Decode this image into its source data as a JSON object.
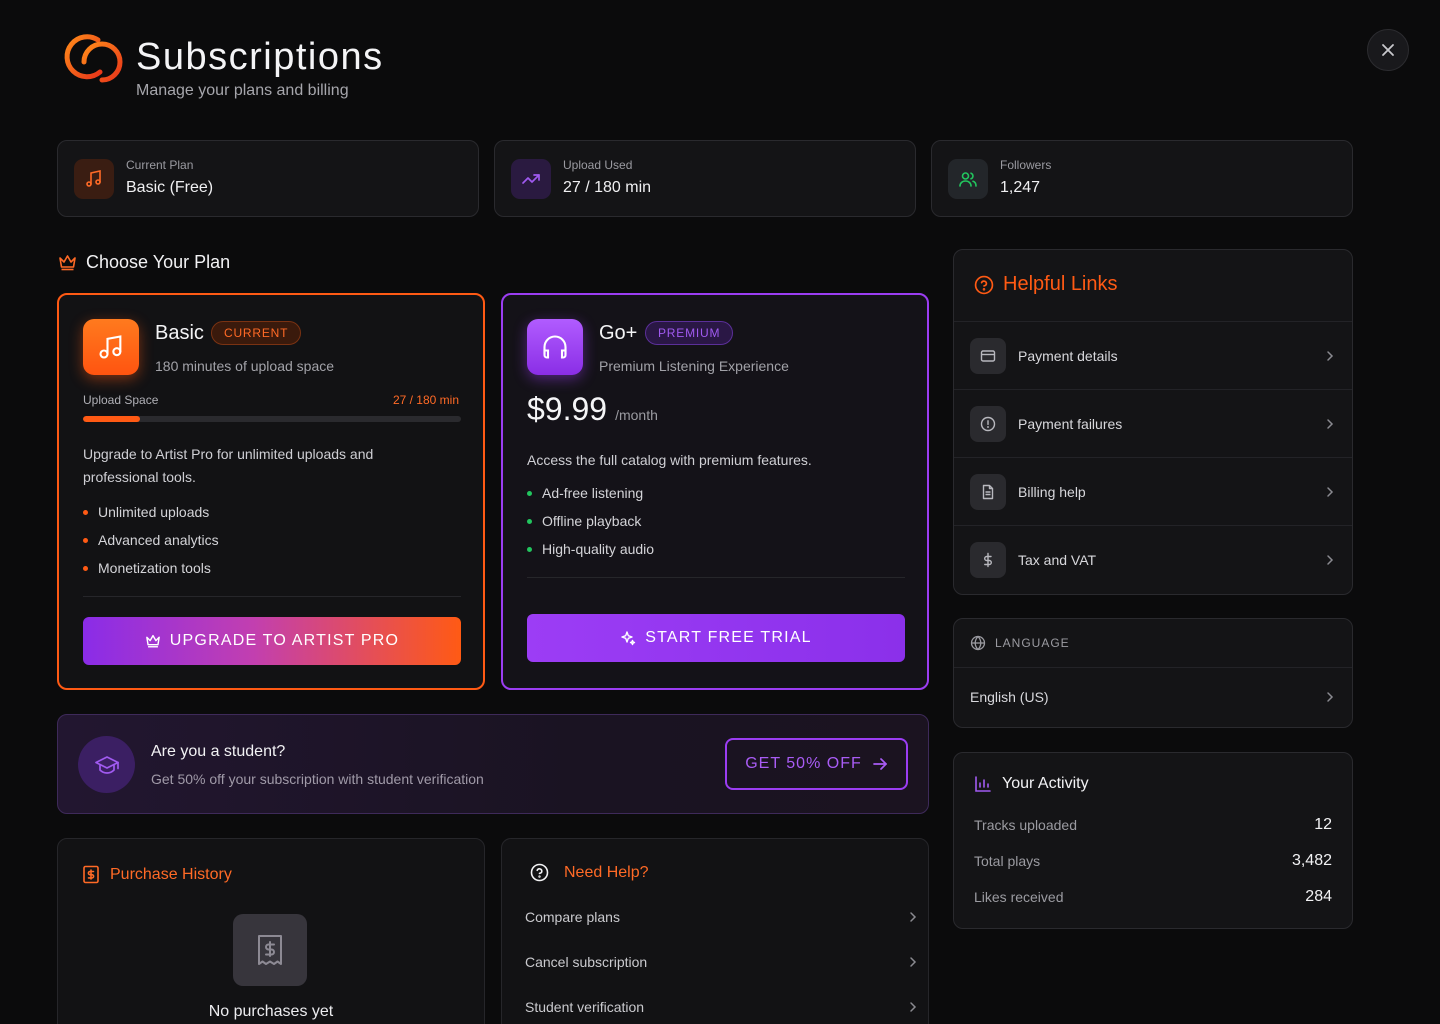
{
  "header": {
    "title": "Subscriptions",
    "subtitle": "Manage your plans and billing"
  },
  "stats": [
    {
      "label": "Current Plan",
      "value": "Basic (Free)",
      "icon": "music-note-icon"
    },
    {
      "label": "Upload Used",
      "value": "27 / 180 min",
      "icon": "trending-up-icon"
    },
    {
      "label": "Followers",
      "value": "1,247",
      "icon": "users-icon"
    }
  ],
  "plans_section": {
    "title": "Choose Your Plan"
  },
  "basic_plan": {
    "name": "Basic",
    "badge": "CURRENT",
    "subtitle": "180 minutes of upload space",
    "usage_label": "Upload Space",
    "usage_value": "27 / 180 min",
    "usage_fraction": 0.15,
    "description": "Upgrade to Artist Pro for unlimited uploads and professional tools.",
    "features": [
      "Unlimited uploads",
      "Advanced analytics",
      "Monetization tools"
    ],
    "cta": "UPGRADE TO ARTIST PRO"
  },
  "go_plan": {
    "name": "Go+",
    "badge": "PREMIUM",
    "subtitle": "Premium Listening Experience",
    "price": "$9.99",
    "period": "/month",
    "description": "Access the full catalog with premium features.",
    "features": [
      "Ad-free listening",
      "Offline playback",
      "High-quality audio"
    ],
    "cta": "START FREE TRIAL"
  },
  "student": {
    "title": "Are you a student?",
    "subtitle": "Get 50% off your subscription with student verification",
    "cta": "GET 50% OFF"
  },
  "purchase_history": {
    "title": "Purchase History",
    "empty_text": "No purchases yet"
  },
  "need_help": {
    "title": "Need Help?",
    "items": [
      "Compare plans",
      "Cancel subscription",
      "Student verification"
    ]
  },
  "helpful_links": {
    "title": "Helpful Links",
    "items": [
      {
        "label": "Payment details",
        "icon": "credit-card-icon"
      },
      {
        "label": "Payment failures",
        "icon": "alert-circle-icon"
      },
      {
        "label": "Billing help",
        "icon": "document-icon"
      },
      {
        "label": "Tax and VAT",
        "icon": "dollar-icon"
      }
    ]
  },
  "language": {
    "title": "LANGUAGE",
    "value": "English (US)"
  },
  "activity": {
    "title": "Your Activity",
    "rows": [
      {
        "label": "Tracks uploaded",
        "value": "12"
      },
      {
        "label": "Total plays",
        "value": "3,482"
      },
      {
        "label": "Likes received",
        "value": "284"
      }
    ]
  },
  "colors": {
    "accent_orange": "#ff5a14",
    "accent_purple": "#9b3df2",
    "accent_green": "#22c55e"
  }
}
